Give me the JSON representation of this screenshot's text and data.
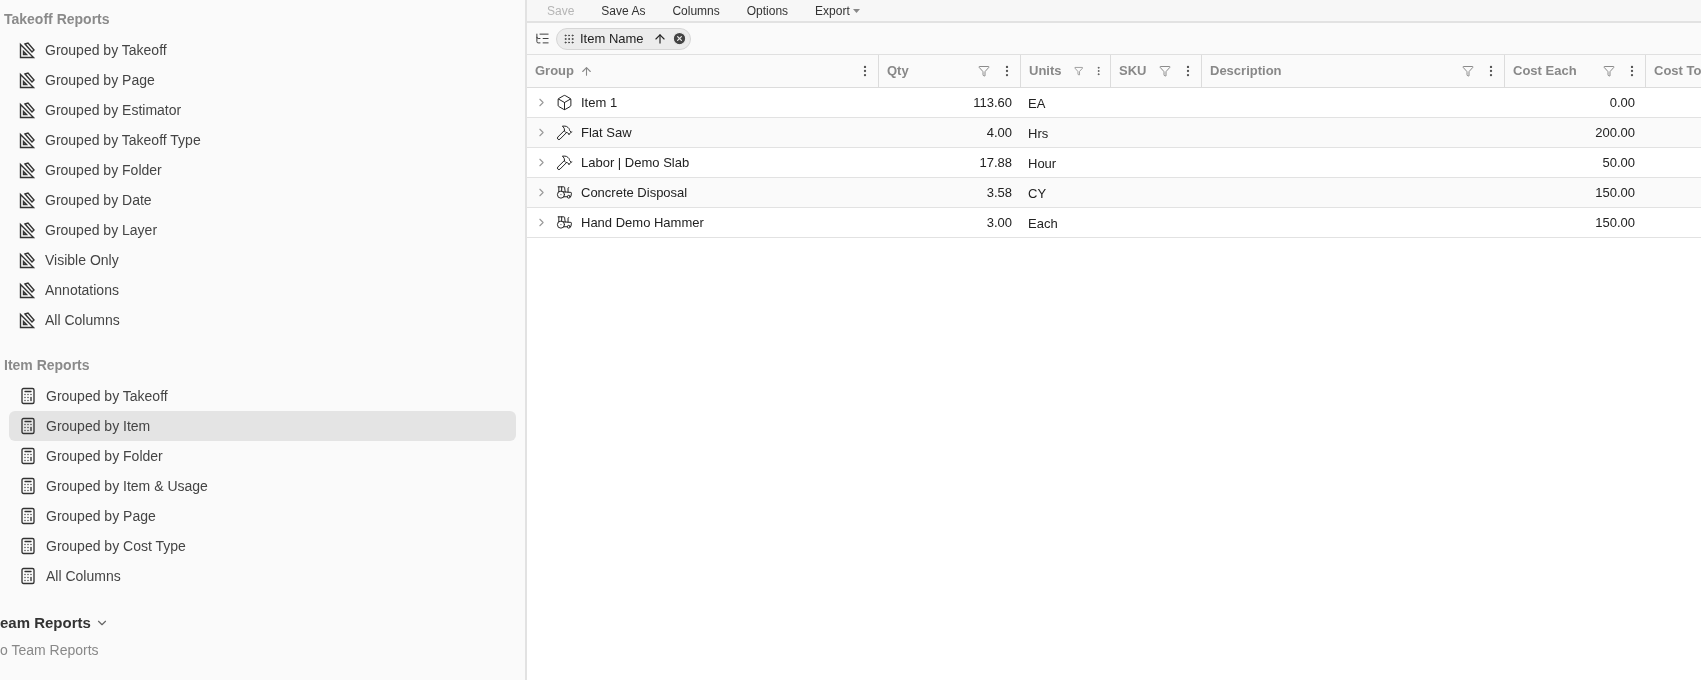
{
  "sidebar": {
    "sections": [
      {
        "heading": "Takeoff Reports",
        "kind": "takeoff",
        "items": [
          {
            "label": "Grouped by Takeoff",
            "selected": false
          },
          {
            "label": "Grouped by Page",
            "selected": false
          },
          {
            "label": "Grouped by Estimator",
            "selected": false
          },
          {
            "label": "Grouped by Takeoff Type",
            "selected": false
          },
          {
            "label": "Grouped by Folder",
            "selected": false
          },
          {
            "label": "Grouped by Date",
            "selected": false
          },
          {
            "label": "Grouped by Layer",
            "selected": false
          },
          {
            "label": "Visible Only",
            "selected": false
          },
          {
            "label": "Annotations",
            "selected": false
          },
          {
            "label": "All Columns",
            "selected": false
          }
        ]
      },
      {
        "heading": "Item Reports",
        "kind": "item",
        "items": [
          {
            "label": "Grouped by Takeoff",
            "selected": false
          },
          {
            "label": "Grouped by Item",
            "selected": true
          },
          {
            "label": "Grouped by Folder",
            "selected": false
          },
          {
            "label": "Grouped by Item & Usage",
            "selected": false
          },
          {
            "label": "Grouped by Page",
            "selected": false
          },
          {
            "label": "Grouped by Cost Type",
            "selected": false
          },
          {
            "label": "All Columns",
            "selected": false
          }
        ]
      }
    ],
    "team": {
      "heading": "eam Reports",
      "expanded": true,
      "empty_text": "o Team Reports"
    }
  },
  "toolbar": [
    {
      "label": "Save",
      "disabled": true,
      "dropdown": false
    },
    {
      "label": "Save As",
      "disabled": false,
      "dropdown": false
    },
    {
      "label": "Columns",
      "disabled": false,
      "dropdown": false
    },
    {
      "label": "Options",
      "disabled": false,
      "dropdown": false
    },
    {
      "label": "Export",
      "disabled": false,
      "dropdown": true
    }
  ],
  "grouping_chip": {
    "label": "Item Name",
    "sort_ascending": true
  },
  "table": {
    "columns": [
      {
        "label": "Group",
        "sort_ascending": true,
        "filter": false,
        "menu": true
      },
      {
        "label": "Qty",
        "filter": true,
        "menu": true
      },
      {
        "label": "Units",
        "filter": true,
        "menu": true
      },
      {
        "label": "SKU",
        "filter": true,
        "menu": true
      },
      {
        "label": "Description",
        "filter": true,
        "menu": true
      },
      {
        "label": "Cost Each",
        "filter": true,
        "menu": true
      },
      {
        "label": "Cost To"
      }
    ],
    "rows": [
      {
        "kind": "item",
        "expanded": false,
        "name": "Item 1",
        "qty": "113.60",
        "units": "EA",
        "cost_each": "0.00"
      },
      {
        "kind": "labor",
        "expanded": false,
        "name": "Flat Saw",
        "qty": "4.00",
        "units": "Hrs",
        "cost_each": "200.00"
      },
      {
        "kind": "labor",
        "expanded": false,
        "name": "Labor | Demo Slab",
        "qty": "17.88",
        "units": "Hour",
        "cost_each": "50.00"
      },
      {
        "kind": "equipment",
        "expanded": false,
        "name": "Concrete Disposal",
        "qty": "3.58",
        "units": "CY",
        "cost_each": "150.00"
      },
      {
        "kind": "equipment",
        "expanded": false,
        "name": "Hand Demo Hammer",
        "qty": "3.00",
        "units": "Each",
        "cost_each": "150.00"
      }
    ]
  }
}
